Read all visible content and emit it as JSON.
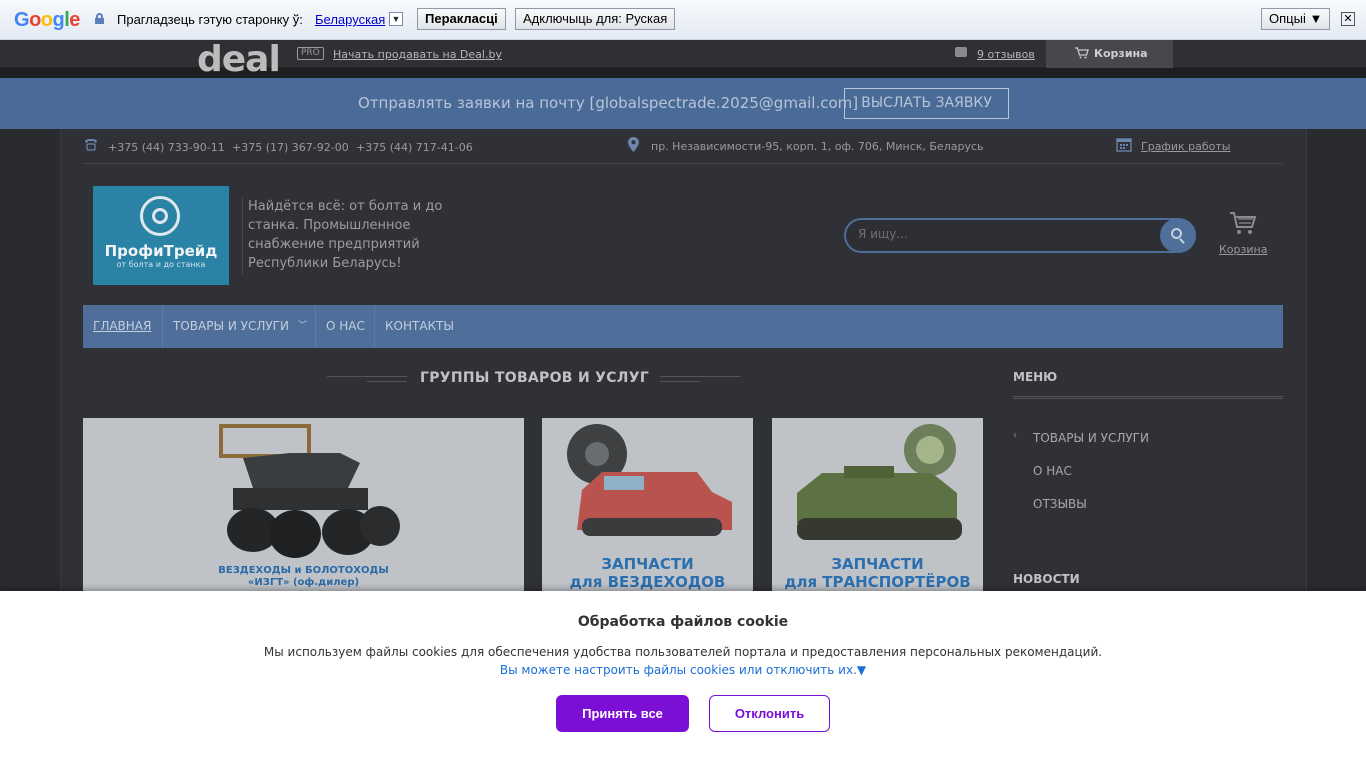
{
  "google_translate": {
    "logo_letters": [
      "G",
      "o",
      "o",
      "g",
      "l",
      "e"
    ],
    "logo_colors": [
      "#4285f4",
      "#ea4335",
      "#fbbc05",
      "#4285f4",
      "#34a853",
      "#ea4335"
    ],
    "prompt": "Прагладзець гэтую старонку ў:",
    "language": "Беларуская",
    "language_arrow": "▼",
    "translate_button": "Перакласці",
    "disable_button": "Адключыць для: Руская",
    "options_button": "Опцыі ▼",
    "close": "✕"
  },
  "deal_bar": {
    "logo": "deal",
    "pro_badge": "PRO",
    "sell_link": "Начать продавать на Deal.by",
    "reviews_link": "9 отзывов",
    "cart_label": "Корзина"
  },
  "banner": {
    "text": "Отправлять заявки на почту [globalspectrade.2025@gmail.com]",
    "button": "ВЫСЛАТЬ ЗАЯВКУ"
  },
  "contacts": {
    "phones": [
      "+375 (44) 733-90-11",
      "+375 (17) 367-92-00",
      "+375 (44) 717-41-06"
    ],
    "address": "пр. Независимости-95, корп. 1, оф. 706, Минск, Беларусь",
    "schedule_link": "График работы"
  },
  "header": {
    "logo_name": "ПрофиТрейд",
    "logo_tagline": "от болта и до станка",
    "slogan": "Найдётся всё: от болта и до станка. Промышленное снабжение предприятий Республики Беларусь!",
    "search_placeholder": "Я ищу...",
    "cart_label": "Корзина"
  },
  "nav": {
    "items": [
      "ГЛАВНАЯ",
      "ТОВАРЫ И УСЛУГИ",
      "О НАС",
      "КОНТАКТЫ"
    ]
  },
  "content": {
    "section_title": "ГРУППЫ ТОВАРОВ И УСЛУГ",
    "cards": [
      {
        "brand": "ИЗГТ",
        "caption_line1": "ВЕЗДЕХОДЫ и БОЛОТОХОДЫ",
        "caption_line2": "«ИЗГТ» (оф.дилер)"
      },
      {
        "caption_line1": "ЗАПЧАСТИ",
        "caption_line2": "для ВЕЗДЕХОДОВ"
      },
      {
        "caption_line1": "ЗАПЧАСТИ",
        "caption_line2": "для ТРАНСПОРТЁРОВ"
      }
    ]
  },
  "sidebar": {
    "menu_title": "МЕНЮ",
    "menu_items": [
      "ТОВАРЫ И УСЛУГИ",
      "О НАС",
      "ОТЗЫВЫ"
    ],
    "news_title": "НОВОСТИ"
  },
  "cookie": {
    "title": "Обработка файлов cookie",
    "text": "Мы используем файлы cookies для обеспечения удобства пользователей портала и предоставления персональных рекомендаций.",
    "link": "Вы можете настроить файлы cookies или отключить их.▼",
    "accept": "Принять все",
    "decline": "Отклонить"
  }
}
